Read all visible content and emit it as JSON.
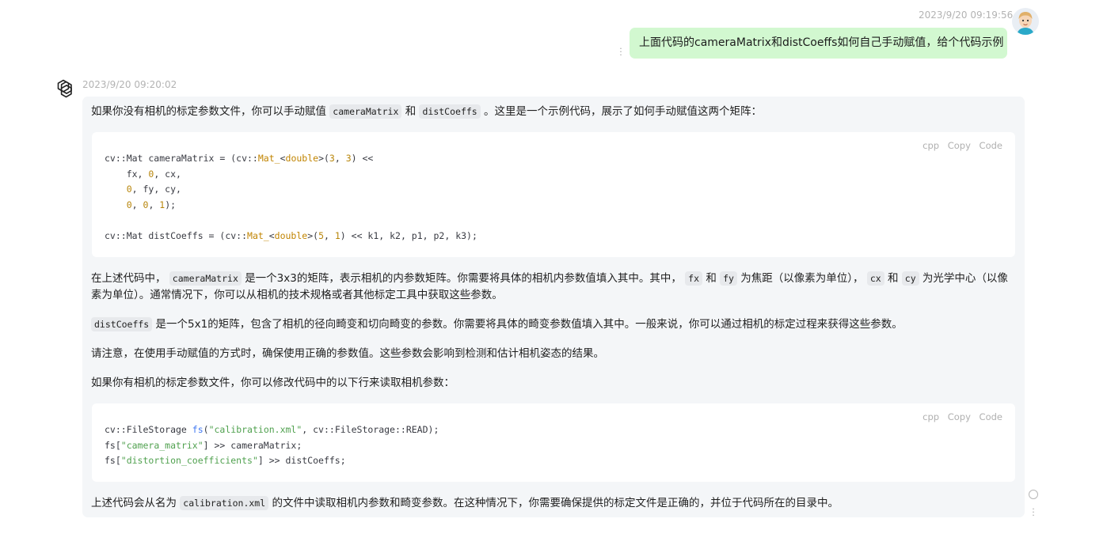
{
  "user_message": {
    "timestamp": "2023/9/20 09:19:56",
    "text": "上面代码的cameraMatrix和distCoeffs如何自己手动赋值，给个代码示例"
  },
  "assistant_message": {
    "timestamp": "2023/9/20 09:20:02",
    "intro": {
      "t1": "如果你没有相机的标定参数文件，你可以手动赋值",
      "c1": "cameraMatrix",
      "t2": "和",
      "c2": "distCoeffs",
      "t3": "。这里是一个示例代码，展示了如何手动赋值这两个矩阵："
    },
    "code_block_1": {
      "lang": "cpp",
      "copy_label": "Copy",
      "code_label": "Code"
    },
    "para_camera": {
      "t1": "在上述代码中，",
      "c1": "cameraMatrix",
      "t2": "是一个3x3的矩阵，表示相机的内参数矩阵。你需要将具体的相机内参数值填入其中。其中，",
      "c2": "fx",
      "t3": "和",
      "c3": "fy",
      "t4": "为焦距（以像素为单位），",
      "c4": "cx",
      "t5": "和",
      "c5": "cy",
      "t6": "为光学中心（以像素为单位）。通常情况下，你可以从相机的技术规格或者其他标定工具中获取这些参数。"
    },
    "para_dist": {
      "c1": "distCoeffs",
      "t1": "是一个5x1的矩阵，包含了相机的径向畸变和切向畸变的参数。你需要将具体的畸变参数值填入其中。一般来说，你可以通过相机的标定过程来获得这些参数。"
    },
    "para_note": "请注意，在使用手动赋值的方式时，确保使用正确的参数值。这些参数会影响到检测和估计相机姿态的结果。",
    "para_file": "如果你有相机的标定参数文件，你可以修改代码中的以下行来读取相机参数：",
    "code_block_2": {
      "lang": "cpp",
      "copy_label": "Copy",
      "code_label": "Code"
    },
    "para_last": {
      "t1": "上述代码会从名为",
      "c1": "calibration.xml",
      "t2": "的文件中读取相机内参数和畸变参数。在这种情况下，你需要确保提供的标定文件是正确的，并位于代码所在的目录中。"
    }
  },
  "icons": {
    "user_avatar": "cartoon-user-avatar",
    "assistant_avatar": "openai-logo-icon",
    "more": "kebab-menu-icon",
    "regenerate": "circle-icon"
  },
  "colors": {
    "user_bubble": "#d2f8d0",
    "assistant_panel": "#f4f6f8",
    "code_bg": "#ffffff"
  }
}
